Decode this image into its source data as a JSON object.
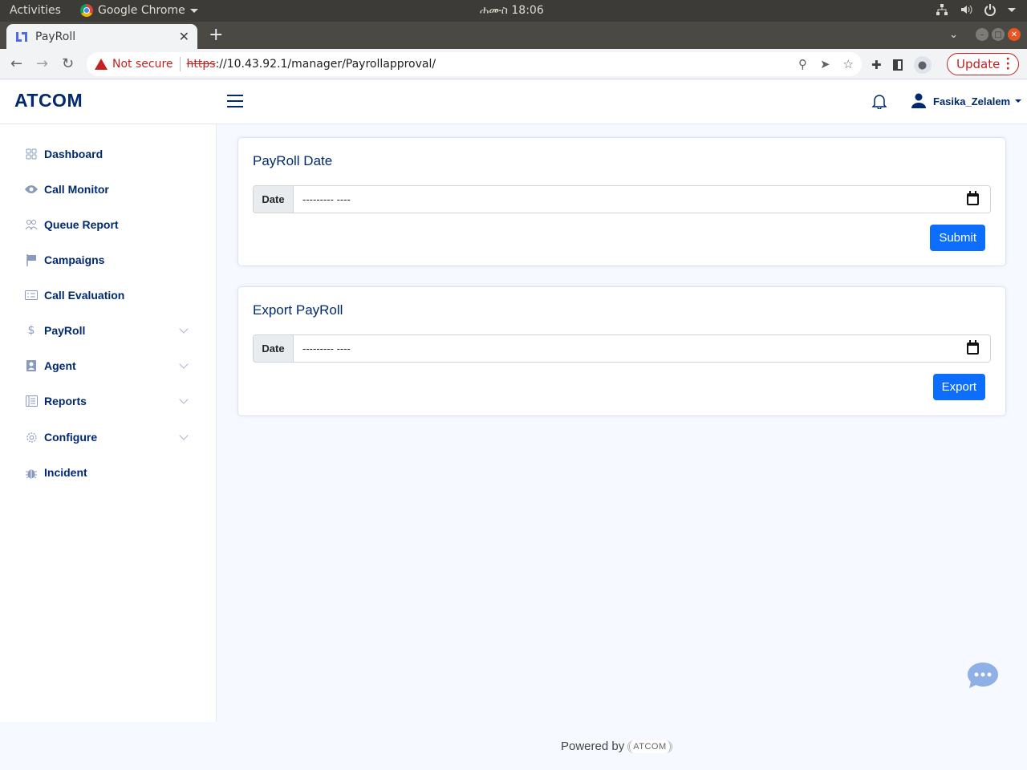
{
  "os": {
    "activities": "Activities",
    "app_name": "Google Chrome",
    "clock": "ሐሙስ 18:06"
  },
  "browser": {
    "tab_title": "PayRoll",
    "url_scheme": "https",
    "url_rest": "://10.43.92.1/manager/Payrollapproval/",
    "security_label": "Not secure",
    "update_label": "Update"
  },
  "header": {
    "logo": "ATCOM",
    "username": "Fasika_Zelalem"
  },
  "sidebar": {
    "items": [
      {
        "label": "Dashboard",
        "icon": "grid-icon",
        "expandable": false
      },
      {
        "label": "Call Monitor",
        "icon": "eye-icon",
        "expandable": false
      },
      {
        "label": "Queue Report",
        "icon": "people-icon",
        "expandable": false
      },
      {
        "label": "Campaigns",
        "icon": "flag-icon",
        "expandable": false
      },
      {
        "label": "Call Evaluation",
        "icon": "card-checklist-icon",
        "expandable": false
      },
      {
        "label": "PayRoll",
        "icon": "dollar-icon",
        "expandable": true
      },
      {
        "label": "Agent",
        "icon": "person-badge-icon",
        "expandable": true
      },
      {
        "label": "Reports",
        "icon": "layout-text-icon",
        "expandable": true
      },
      {
        "label": "Configure",
        "icon": "gear-icon",
        "expandable": true
      },
      {
        "label": "Incident",
        "icon": "bug-icon",
        "expandable": false
      }
    ]
  },
  "cards": {
    "payroll_date": {
      "title": "PayRoll Date",
      "input_label": "Date",
      "input_value": "--------- ----",
      "button_label": "Submit"
    },
    "export_payroll": {
      "title": "Export PayRoll",
      "input_label": "Date",
      "input_value": "--------- ----",
      "button_label": "Export"
    }
  },
  "footer": {
    "powered_by": "Powered by",
    "brand": "ATCOM"
  },
  "colors": {
    "brand": "#012970",
    "primary_button": "#0d6efd",
    "page_bg": "#f6f9ff",
    "chat_bubble": "#8fb0e6"
  }
}
